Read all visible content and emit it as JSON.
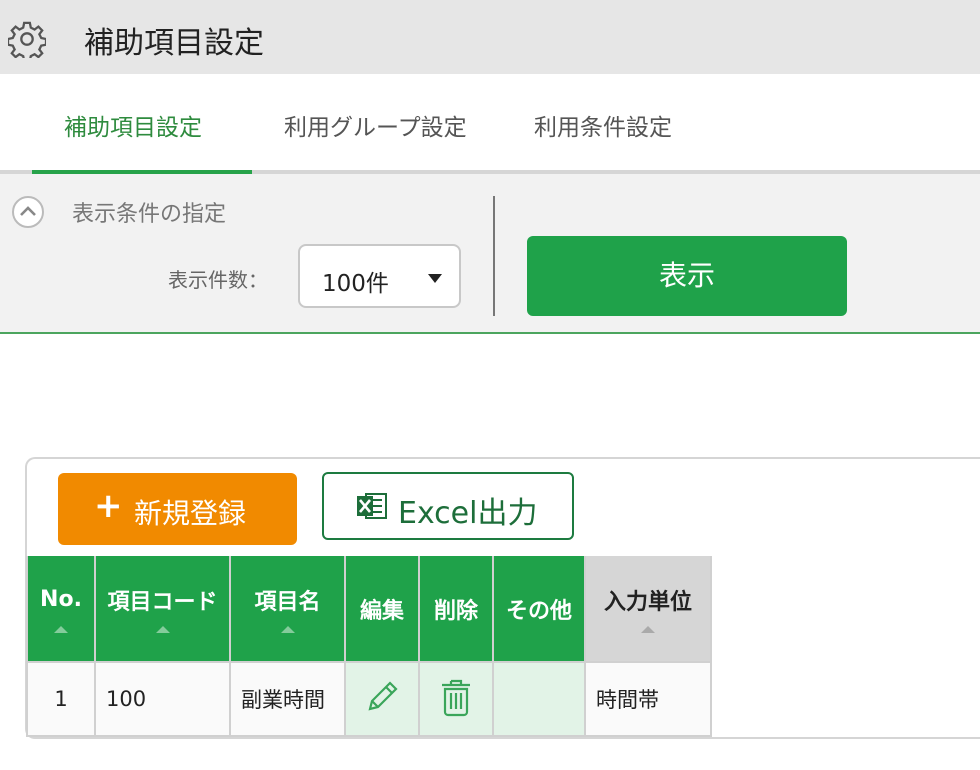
{
  "header": {
    "title": "補助項目設定",
    "icon": "gear-icon"
  },
  "tabs": [
    {
      "label": "補助項目設定",
      "active": true
    },
    {
      "label": "利用グループ設定",
      "active": false
    },
    {
      "label": "利用条件設定",
      "active": false
    }
  ],
  "filter": {
    "heading": "表示条件の指定",
    "count_label": "表示件数：",
    "count_value": "100件",
    "show_button": "表示"
  },
  "toolbar": {
    "new_button": "新規登録",
    "new_plus": "+",
    "excel_button": "Excel出力"
  },
  "table": {
    "headers": [
      "No.",
      "項目コード",
      "項目名",
      "編集",
      "削除",
      "その他",
      "入力単位"
    ],
    "rows": [
      {
        "no": "1",
        "code": "100",
        "name": "副業時間",
        "unit": "時間帯"
      }
    ]
  },
  "colors": {
    "accent_green": "#1fa24a",
    "orange": "#f18a00",
    "header_bg": "#e6e6e6"
  }
}
